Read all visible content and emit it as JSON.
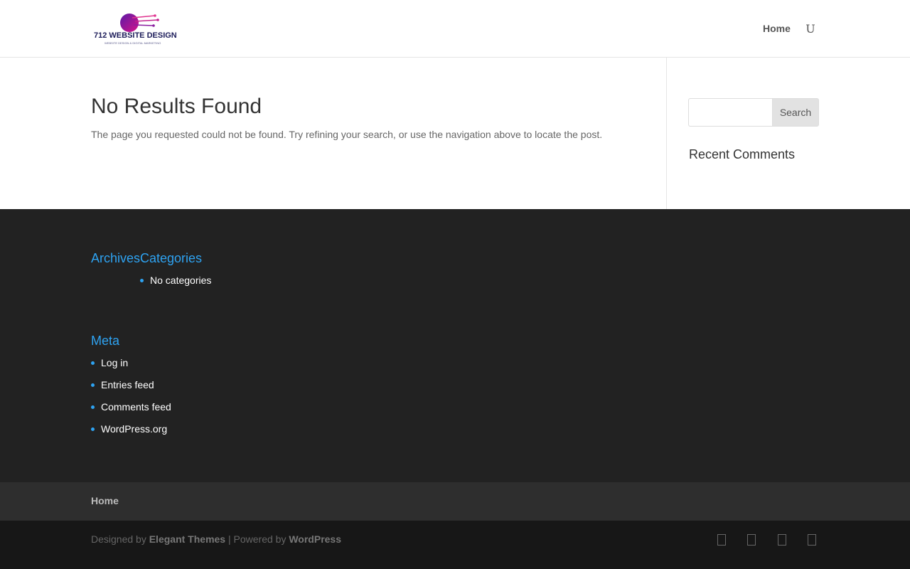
{
  "header": {
    "logo_text": "712 WEBSITE DESIGN",
    "logo_tagline": "WEBSITE DESIGN & DIGITAL MARKETING",
    "nav": {
      "home_label": "Home"
    },
    "search_toggle_glyph": "U"
  },
  "main": {
    "title": "No Results Found",
    "description": "The page you requested could not be found. Try refining your search, or use the navigation above to locate the post."
  },
  "sidebar": {
    "search_placeholder": "",
    "search_button_label": "Search",
    "recent_comments_title": "Recent Comments"
  },
  "footer": {
    "archives_title": "Archives",
    "categories_title": "Categories",
    "categories_items": [
      "No categories"
    ],
    "meta_title": "Meta",
    "meta_items": [
      "Log in",
      "Entries feed",
      "Comments feed",
      "WordPress.org"
    ]
  },
  "bottom_nav": {
    "home_label": "Home"
  },
  "credits": {
    "designed_by": "Designed by",
    "theme_author": "Elegant Themes",
    "separator": "| Powered by",
    "platform": "WordPress"
  },
  "social_icons": [
    "facebook-icon",
    "twitter-icon",
    "google-plus-icon",
    "rss-icon"
  ],
  "colors": {
    "accent": "#2ea3f2",
    "footer_bg": "#222222",
    "bottom_nav_bg": "#2e2e2e",
    "bottom_bar_bg": "#171717"
  }
}
